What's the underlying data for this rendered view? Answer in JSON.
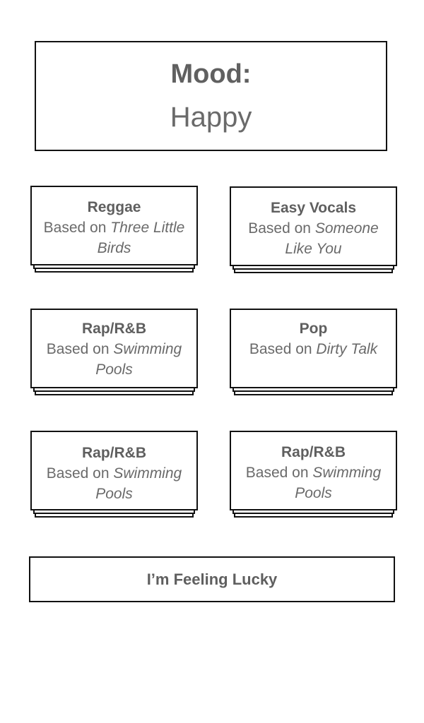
{
  "mood": {
    "label": "Mood:",
    "value": "Happy"
  },
  "stations": [
    {
      "genre": "Reggae",
      "based_on_prefix": "Based on",
      "song": "Three Little Birds"
    },
    {
      "genre": "Easy Vocals",
      "based_on_prefix": "Based on",
      "song": "Someone Like You"
    },
    {
      "genre": "Rap/R&B",
      "based_on_prefix": "Based on",
      "song": "Swimming Pools"
    },
    {
      "genre": "Pop",
      "based_on_prefix": "Based on",
      "song": "Dirty Talk"
    },
    {
      "genre": "Rap/R&B",
      "based_on_prefix": "Based on",
      "song": "Swimming Pools"
    },
    {
      "genre": "Rap/R&B",
      "based_on_prefix": "Based on",
      "song": "Swimming Pools"
    }
  ],
  "lucky_button": {
    "label": "I’m Feeling Lucky"
  }
}
